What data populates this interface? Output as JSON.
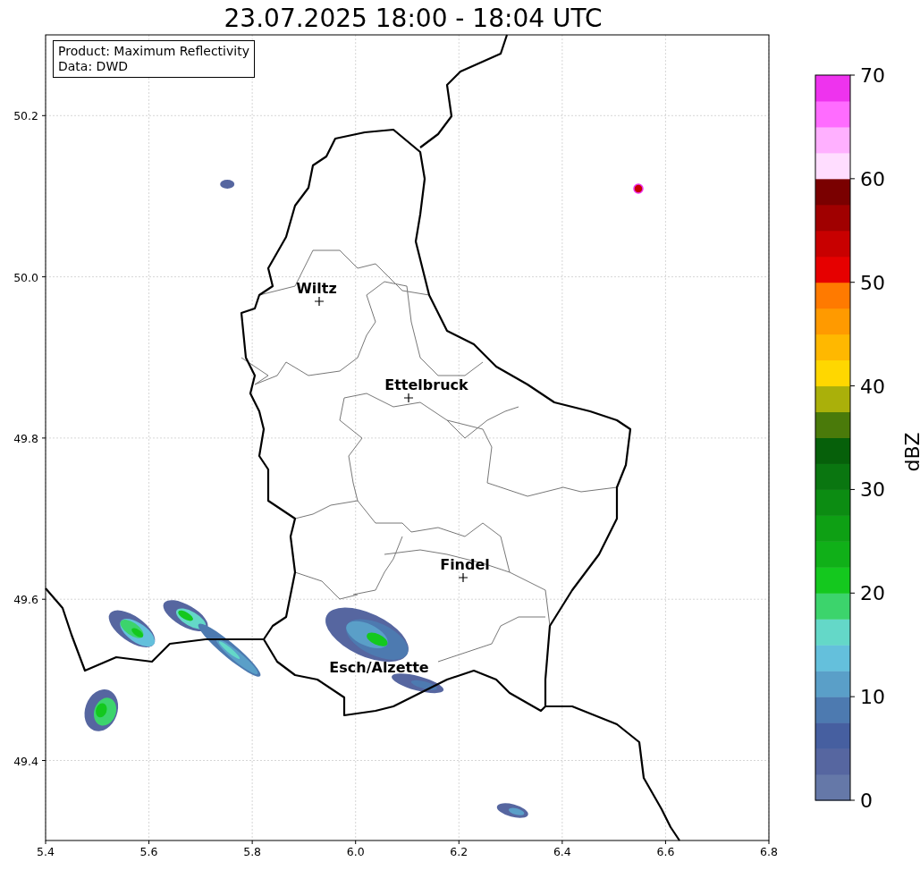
{
  "title": "23.07.2025 18:00 - 18:04 UTC",
  "info_box": [
    "Product: Maximum Reflectivity",
    "Data: DWD"
  ],
  "x_ticks": [
    "5.4",
    "5.6",
    "5.8",
    "6.0",
    "6.2",
    "6.4",
    "6.6",
    "6.8"
  ],
  "y_ticks": [
    "50.2",
    "50.0",
    "49.8",
    "49.6",
    "49.4"
  ],
  "cities": [
    {
      "name": "Wiltz"
    },
    {
      "name": "Ettelbruck"
    },
    {
      "name": "Findel"
    },
    {
      "name": "Esch/Alzette"
    }
  ],
  "colorbar": {
    "label": "dBZ",
    "ticks": [
      "70",
      "60",
      "50",
      "40",
      "30",
      "20",
      "10",
      "0"
    ],
    "segments": [
      {
        "color": "#6578a8"
      },
      {
        "color": "#5666a0"
      },
      {
        "color": "#465fa0"
      },
      {
        "color": "#4d7ab0"
      },
      {
        "color": "#5a9fc8"
      },
      {
        "color": "#64c0dc"
      },
      {
        "color": "#64d8c8"
      },
      {
        "color": "#3cd46c"
      },
      {
        "color": "#14c81e"
      },
      {
        "color": "#10b018"
      },
      {
        "color": "#0ea014"
      },
      {
        "color": "#0c8c12"
      },
      {
        "color": "#0a7610"
      },
      {
        "color": "#06600a"
      },
      {
        "color": "#4a7a0a"
      },
      {
        "color": "#aab00a"
      },
      {
        "color": "#ffd700"
      },
      {
        "color": "#ffb800"
      },
      {
        "color": "#ff9a00"
      },
      {
        "color": "#ff7a00"
      },
      {
        "color": "#e60000"
      },
      {
        "color": "#c80000"
      },
      {
        "color": "#a00000"
      },
      {
        "color": "#7a0000"
      },
      {
        "color": "#ffddff"
      },
      {
        "color": "#ffb0ff"
      },
      {
        "color": "#ff6cff"
      },
      {
        "color": "#ee33ee"
      }
    ]
  }
}
